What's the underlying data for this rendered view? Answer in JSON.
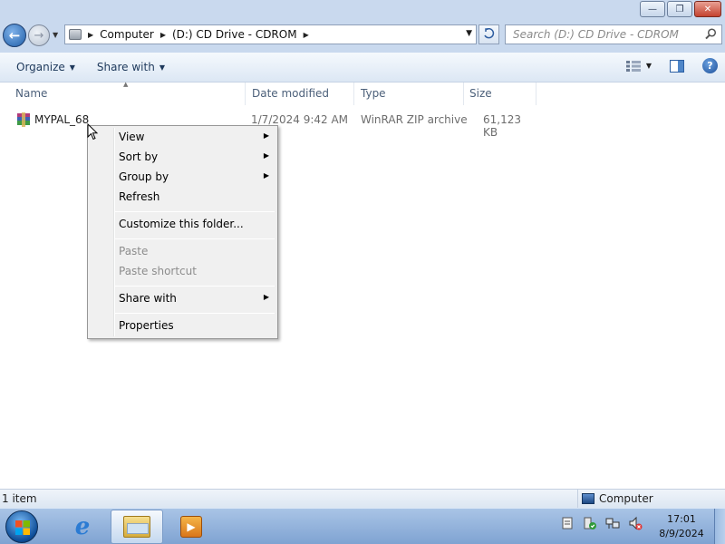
{
  "address": {
    "crumbs": [
      "Computer",
      "(D:) CD Drive - CDROM"
    ]
  },
  "search": {
    "placeholder": "Search (D:) CD Drive - CDROM"
  },
  "toolbar": {
    "organize": "Organize",
    "share_with": "Share with"
  },
  "columns": [
    "Name",
    "Date modified",
    "Type",
    "Size"
  ],
  "files": [
    {
      "name": "MYPAL_68",
      "date_modified": "1/7/2024 9:42 AM",
      "type": "WinRAR ZIP archive",
      "size": "61,123 KB",
      "icon": "winrar-archive-icon"
    }
  ],
  "context_menu": {
    "items": [
      {
        "label": "View",
        "submenu": true,
        "disabled": false
      },
      {
        "label": "Sort by",
        "submenu": true,
        "disabled": false
      },
      {
        "label": "Group by",
        "submenu": true,
        "disabled": false
      },
      {
        "label": "Refresh",
        "submenu": false,
        "disabled": false
      },
      {
        "label": "Customize this folder...",
        "submenu": false,
        "disabled": false
      },
      {
        "label": "Paste",
        "submenu": false,
        "disabled": true
      },
      {
        "label": "Paste shortcut",
        "submenu": false,
        "disabled": true
      },
      {
        "label": "Share with",
        "submenu": true,
        "disabled": false
      },
      {
        "label": "Properties",
        "submenu": false,
        "disabled": false
      }
    ]
  },
  "status": {
    "item_count": "1 item",
    "location": "Computer"
  },
  "taskbar": {
    "time": "17:01",
    "date": "8/9/2024"
  },
  "colors": {
    "chrome": "#c9d9ee",
    "taskbar": "#8fb0da",
    "menu_bg": "#f0f0f0"
  }
}
